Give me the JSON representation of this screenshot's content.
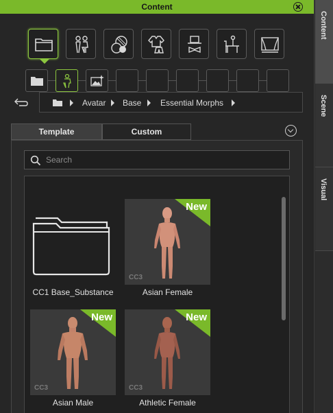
{
  "window": {
    "title": "Content"
  },
  "side_tabs": [
    {
      "label": "Content",
      "active": true
    },
    {
      "label": "Scene",
      "active": false
    },
    {
      "label": "Visual",
      "active": false
    }
  ],
  "category_icons": [
    "folder-icon",
    "avatar-pair-icon",
    "materials-icon",
    "clothes-icon",
    "accessory-icon",
    "prop-icon",
    "stage-icon"
  ],
  "sub_icons": [
    "folder-icon",
    "avatar-body-icon",
    "image-edit-icon"
  ],
  "breadcrumb": {
    "items": [
      "Avatar",
      "Base",
      "Essential Morphs"
    ]
  },
  "tabs": {
    "template": "Template",
    "custom": "Custom"
  },
  "search": {
    "placeholder": "Search",
    "value": ""
  },
  "items": [
    {
      "label": "CC1 Base_Substance",
      "type": "folder"
    },
    {
      "label": "Asian Female",
      "badge": "New",
      "tag": "CC3"
    },
    {
      "label": "Asian Male",
      "badge": "New",
      "tag": "CC3"
    },
    {
      "label": "Athletic Female",
      "badge": "New",
      "tag": "CC3"
    }
  ],
  "colors": {
    "accent": "#8cc63f",
    "titlebar": "#7ab92a",
    "badge": "#7ab92a"
  }
}
